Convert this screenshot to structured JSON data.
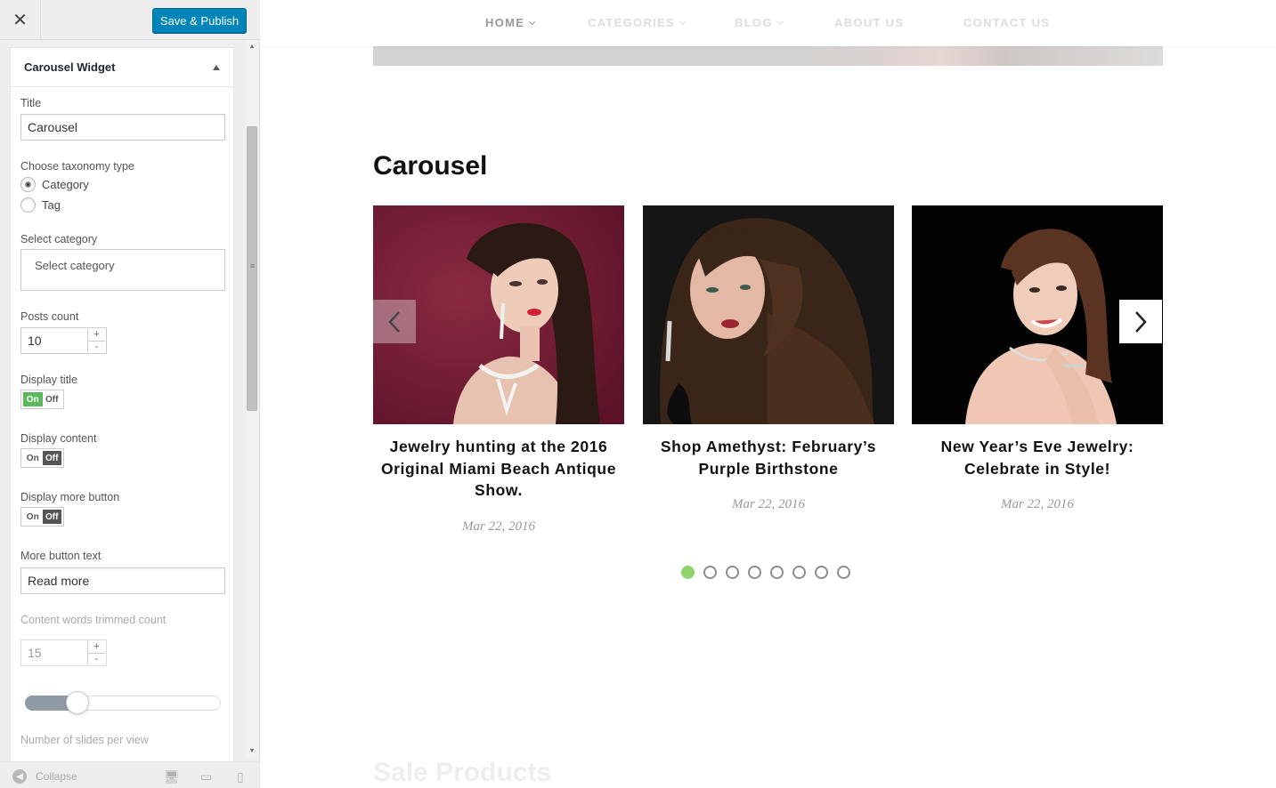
{
  "sidebar": {
    "close_icon": "close-icon",
    "publish_label": "Save & Publish",
    "widget_title": "Carousel Widget",
    "title_label": "Title",
    "title_value": "Carousel",
    "taxonomy_label": "Choose taxonomy type",
    "taxonomy_options": [
      {
        "label": "Category",
        "checked": true
      },
      {
        "label": "Tag",
        "checked": false
      }
    ],
    "select_category_label": "Select category",
    "select_category_placeholder": "Select category",
    "posts_count_label": "Posts count",
    "posts_count_value": "10",
    "display_title_label": "Display title",
    "display_title_state": "On",
    "display_content_label": "Display content",
    "display_content_state": "Off",
    "display_more_label": "Display more button",
    "display_more_state": "Off",
    "toggle_on": "On",
    "toggle_off": "Off",
    "more_text_label": "More button text",
    "more_text_value": "Read more",
    "trim_label": "Content words trimmed count",
    "trim_value": "15",
    "slides_label": "Number of slides per view",
    "collapse_label": "Collapse",
    "spin_up": "+",
    "spin_down": "-"
  },
  "nav": {
    "items": [
      {
        "label": "HOME",
        "has_dropdown": true,
        "active": true
      },
      {
        "label": "CATEGORIES",
        "has_dropdown": true,
        "active": false
      },
      {
        "label": "BLOG",
        "has_dropdown": true,
        "active": false
      },
      {
        "label": "ABOUT US",
        "has_dropdown": false,
        "active": false
      },
      {
        "label": "CONTACT US",
        "has_dropdown": false,
        "active": false
      }
    ]
  },
  "carousel": {
    "title": "Carousel",
    "cards": [
      {
        "title": "Jewelry hunting at the 2016 Original Miami Beach Antique Show.",
        "date": "Mar 22, 2016"
      },
      {
        "title": "Shop Amethyst: February’s Purple Birthstone",
        "date": "Mar 22, 2016"
      },
      {
        "title": "New Year’s Eve Jewelry: Celebrate in Style!",
        "date": "Mar 22, 2016"
      }
    ],
    "dot_count": 8,
    "active_dot": 0
  },
  "next_section_title": "Sale Products",
  "colors": {
    "publish": "#0085ba",
    "toggle_on": "#5cb85c",
    "active_dot": "#8fd46c"
  }
}
